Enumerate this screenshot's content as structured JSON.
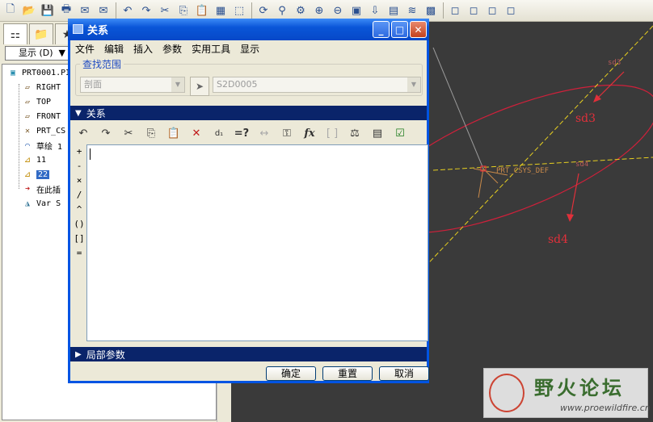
{
  "model_tree": {
    "show_label": "显示 (D)",
    "show_arrow": "▼",
    "nodes": [
      {
        "label": "PRT0001.PI"
      },
      {
        "label": "RIGHT"
      },
      {
        "label": "TOP"
      },
      {
        "label": "FRONT"
      },
      {
        "label": "PRT_CS"
      },
      {
        "label": "草绘 1"
      },
      {
        "label": "11"
      },
      {
        "label": "22"
      },
      {
        "label": "在此插"
      },
      {
        "label": "Var S"
      }
    ]
  },
  "graphics": {
    "csys_label": "PRT_CSYS_DEF",
    "dims": {
      "sd3": "sd3",
      "sd4": "sd4",
      "sd3_small": "sd3",
      "sd4_small": "sd4"
    },
    "colors": {
      "background": "#3a3a3a",
      "ellipse": "#d0203a",
      "datum": "#e8d020",
      "dimension": "#e0303a"
    },
    "watermark": {
      "title": "野火论坛",
      "url": "www.proewildfire.cn"
    }
  },
  "dialog": {
    "title": "关系",
    "menu": [
      "文件",
      "编辑",
      "插入",
      "参数",
      "实用工具",
      "显示"
    ],
    "scope": {
      "legend": "查找范围",
      "type_value": "剖面",
      "section_value": "S2D0005"
    },
    "relations_section": "关系",
    "local_params_section": "局部参数",
    "operators": [
      "+",
      "-",
      "×",
      "/",
      "^",
      "()",
      "[]",
      "="
    ],
    "editor_text": "",
    "buttons": {
      "ok": "确定",
      "reset": "重置",
      "cancel": "取消"
    }
  }
}
